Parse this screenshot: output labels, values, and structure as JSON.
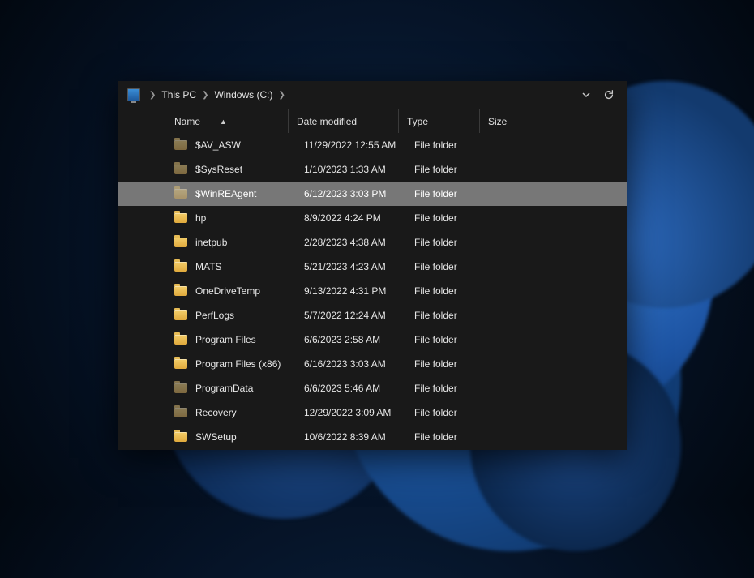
{
  "breadcrumb": {
    "items": [
      "This PC",
      "Windows (C:)"
    ]
  },
  "columns": {
    "name": "Name",
    "date": "Date modified",
    "type": "Type",
    "size": "Size",
    "sort_column": "name",
    "sort_dir": "asc"
  },
  "rows": [
    {
      "name": "$AV_ASW",
      "date": "11/29/2022 12:55 AM",
      "type": "File folder",
      "size": "",
      "hidden": true,
      "selected": false
    },
    {
      "name": "$SysReset",
      "date": "1/10/2023 1:33 AM",
      "type": "File folder",
      "size": "",
      "hidden": true,
      "selected": false
    },
    {
      "name": "$WinREAgent",
      "date": "6/12/2023 3:03 PM",
      "type": "File folder",
      "size": "",
      "hidden": true,
      "selected": true
    },
    {
      "name": "hp",
      "date": "8/9/2022 4:24 PM",
      "type": "File folder",
      "size": "",
      "hidden": false,
      "selected": false
    },
    {
      "name": "inetpub",
      "date": "2/28/2023 4:38 AM",
      "type": "File folder",
      "size": "",
      "hidden": false,
      "selected": false
    },
    {
      "name": "MATS",
      "date": "5/21/2023 4:23 AM",
      "type": "File folder",
      "size": "",
      "hidden": false,
      "selected": false
    },
    {
      "name": "OneDriveTemp",
      "date": "9/13/2022 4:31 PM",
      "type": "File folder",
      "size": "",
      "hidden": false,
      "selected": false
    },
    {
      "name": "PerfLogs",
      "date": "5/7/2022 12:24 AM",
      "type": "File folder",
      "size": "",
      "hidden": false,
      "selected": false
    },
    {
      "name": "Program Files",
      "date": "6/6/2023 2:58 AM",
      "type": "File folder",
      "size": "",
      "hidden": false,
      "selected": false
    },
    {
      "name": "Program Files (x86)",
      "date": "6/16/2023 3:03 AM",
      "type": "File folder",
      "size": "",
      "hidden": false,
      "selected": false
    },
    {
      "name": "ProgramData",
      "date": "6/6/2023 5:46 AM",
      "type": "File folder",
      "size": "",
      "hidden": true,
      "selected": false
    },
    {
      "name": "Recovery",
      "date": "12/29/2022 3:09 AM",
      "type": "File folder",
      "size": "",
      "hidden": true,
      "selected": false
    },
    {
      "name": "SWSetup",
      "date": "10/6/2022 8:39 AM",
      "type": "File folder",
      "size": "",
      "hidden": false,
      "selected": false
    }
  ]
}
